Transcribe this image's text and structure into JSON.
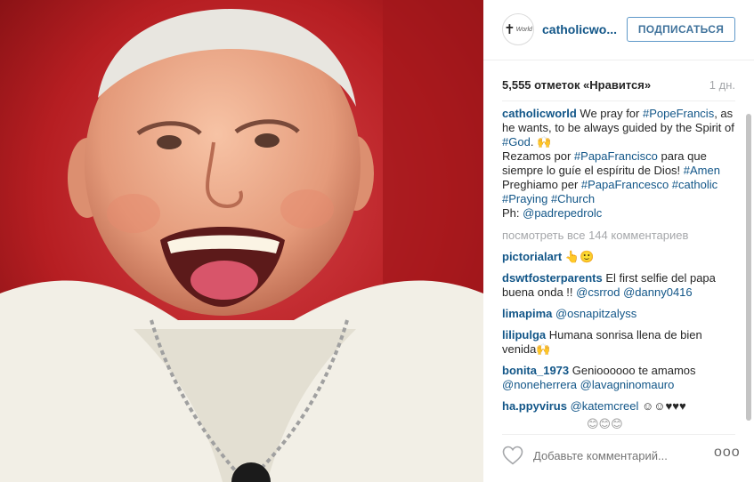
{
  "header": {
    "username": "catholicwo...",
    "avatar_logo": {
      "glyph": "✝",
      "word": "World"
    },
    "follow_label": "ПОДПИСАТЬСЯ"
  },
  "stats": {
    "likes": "5,555 отметок «Нравится»",
    "time_ago": "1 дн."
  },
  "caption": {
    "user": "catholicworld",
    "lines": [
      [
        {
          "t": "We pray for "
        },
        {
          "t": "#PopeFrancis",
          "link": true
        },
        {
          "t": ", as he wants, to be always guided by the Spirit of "
        },
        {
          "t": "#God",
          "link": true
        },
        {
          "t": ". 🙌"
        }
      ],
      [
        {
          "t": "Rezamos por "
        },
        {
          "t": "#PapaFrancisco",
          "link": true
        },
        {
          "t": " para que siempre lo guíe el espíritu de Dios! "
        },
        {
          "t": "#Amen",
          "link": true
        }
      ],
      [
        {
          "t": "Preghiamo per "
        },
        {
          "t": "#PapaFrancesco",
          "link": true
        },
        {
          "t": " "
        },
        {
          "t": "#catholic",
          "link": true
        },
        {
          "t": " "
        },
        {
          "t": "#Praying",
          "link": true
        },
        {
          "t": " "
        },
        {
          "t": "#Church",
          "link": true
        }
      ],
      [
        {
          "t": "Ph: "
        },
        {
          "t": "@padrepedrolc",
          "link": true
        }
      ]
    ]
  },
  "view_all_comments": "посмотреть все 144 комментариев",
  "comments": [
    {
      "user": "pictorialart",
      "parts": [
        {
          "t": " 👆🙂"
        }
      ]
    },
    {
      "user": "dswtfosterparents",
      "parts": [
        {
          "t": " El first selfie del papa buena onda !! "
        },
        {
          "t": "@csrrod",
          "link": true
        },
        {
          "t": " "
        },
        {
          "t": "@danny0416",
          "link": true
        }
      ]
    },
    {
      "user": "limapima",
      "parts": [
        {
          "t": " "
        },
        {
          "t": "@osnapitzalyss",
          "link": true
        }
      ]
    },
    {
      "user": "lilipulga",
      "parts": [
        {
          "t": " Humana sonrisa llena de bien venida🙌"
        }
      ]
    },
    {
      "user": "bonita_1973",
      "parts": [
        {
          "t": " Genioooooo te amamos "
        },
        {
          "t": "@noneherrera",
          "link": true
        },
        {
          "t": " "
        },
        {
          "t": "@lavagninomauro",
          "link": true
        }
      ]
    },
    {
      "user": "ha.ppyvirus",
      "parts": [
        {
          "t": " "
        },
        {
          "t": "@katemcreel",
          "link": true
        },
        {
          "t": " ☺☺♥♥♥"
        }
      ]
    }
  ],
  "partial_line": "😊😊😊",
  "footer": {
    "add_comment_placeholder": "Добавьте комментарий...",
    "more_label": "ooo",
    "like_icon": "heart-outline-icon"
  },
  "colors": {
    "link": "#125688",
    "follow_border": "#5f99c9",
    "follow_text": "#3f729b",
    "muted": "#a5a7aa",
    "photo_background": "#b11a1e"
  }
}
